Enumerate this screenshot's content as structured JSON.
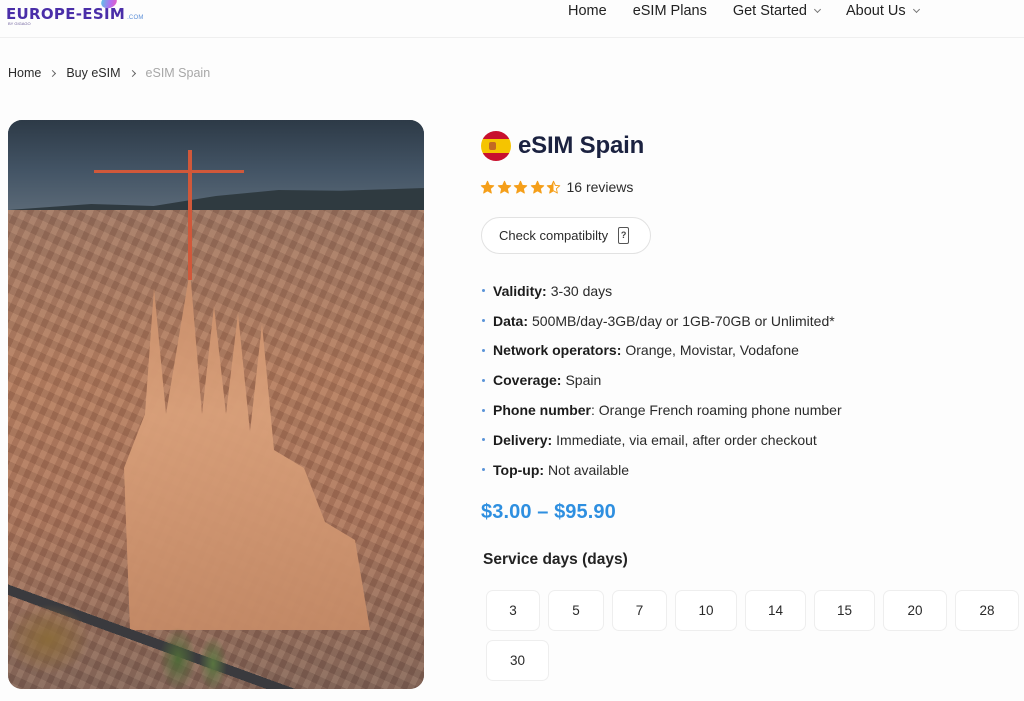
{
  "header": {
    "logo": {
      "text": "EUROPE-ESIM",
      "suffix": ".COM",
      "byline": "BY GIGAGO"
    },
    "nav": [
      {
        "label": "Home",
        "has_dropdown": false
      },
      {
        "label": "eSIM Plans",
        "has_dropdown": false
      },
      {
        "label": "Get Started",
        "has_dropdown": true
      },
      {
        "label": "About Us",
        "has_dropdown": true
      }
    ]
  },
  "breadcrumb": [
    {
      "label": "Home"
    },
    {
      "label": "Buy eSIM"
    },
    {
      "label": "eSIM Spain",
      "current": true
    }
  ],
  "product": {
    "image_alt": "Aerial view of Sagrada Familia, Barcelona",
    "flag_icon": "spain-flag-icon",
    "title": "eSIM Spain",
    "rating": {
      "value": 4.5,
      "max": 5,
      "reviews_label": "16 reviews",
      "star_color": "#f59f1a"
    },
    "compat_button": {
      "label": "Check compatibilty",
      "icon": "phone-question-icon"
    },
    "specs": [
      {
        "label": "Validity:",
        "value": "3-30 days"
      },
      {
        "label": "Data:",
        "value": "500MB/day-3GB/day or 1GB-70GB or Unlimited*"
      },
      {
        "label": "Network operators:",
        "value": "Orange, Movistar, Vodafone"
      },
      {
        "label": "Coverage:",
        "value": "Spain"
      },
      {
        "label": "Phone number",
        "value": ": Orange French roaming phone number"
      },
      {
        "label": "Delivery:",
        "value": "Immediate, via email, after order checkout"
      },
      {
        "label": "Top-up:",
        "value": "Not available"
      }
    ],
    "price_range": "$3.00 – $95.90",
    "price_color": "#2e8fe0",
    "service_days_label": "Service days (days)",
    "service_days_options": [
      "3",
      "5",
      "7",
      "10",
      "14",
      "15",
      "20",
      "28",
      "30"
    ]
  }
}
